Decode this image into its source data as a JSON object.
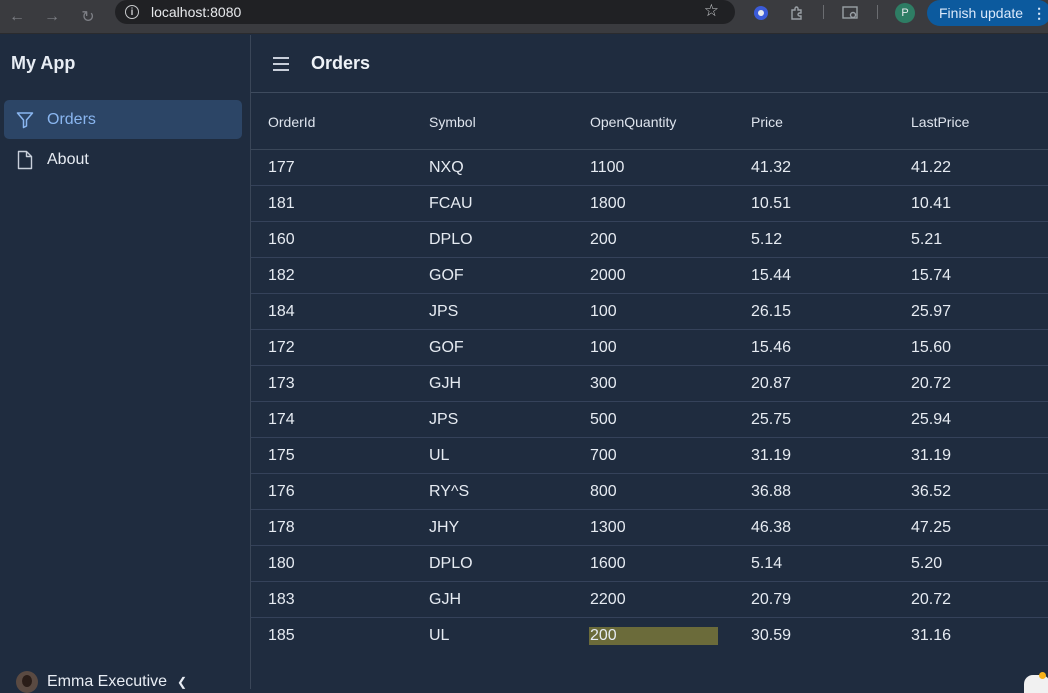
{
  "browser": {
    "url": "localhost:8080",
    "profile_initial": "P",
    "update_label": "Finish update"
  },
  "app": {
    "title": "My App"
  },
  "sidebar": {
    "items": [
      {
        "label": "Orders",
        "icon": "filter-icon",
        "active": true
      },
      {
        "label": "About",
        "icon": "file-icon",
        "active": false
      }
    ]
  },
  "user": {
    "name": "Emma Executive"
  },
  "header": {
    "title": "Orders"
  },
  "table": {
    "columns": [
      "OrderId",
      "Symbol",
      "OpenQuantity",
      "Price",
      "LastPrice"
    ],
    "rows": [
      [
        "177",
        "NXQ",
        "1100",
        "41.32",
        "41.22"
      ],
      [
        "181",
        "FCAU",
        "1800",
        "10.51",
        "10.41"
      ],
      [
        "160",
        "DPLO",
        "200",
        "5.12",
        "5.21"
      ],
      [
        "182",
        "GOF",
        "2000",
        "15.44",
        "15.74"
      ],
      [
        "184",
        "JPS",
        "100",
        "26.15",
        "25.97"
      ],
      [
        "172",
        "GOF",
        "100",
        "15.46",
        "15.60"
      ],
      [
        "173",
        "GJH",
        "300",
        "20.87",
        "20.72"
      ],
      [
        "174",
        "JPS",
        "500",
        "25.75",
        "25.94"
      ],
      [
        "175",
        "UL",
        "700",
        "31.19",
        "31.19"
      ],
      [
        "176",
        "RY^S",
        "800",
        "36.88",
        "36.52"
      ],
      [
        "178",
        "JHY",
        "1300",
        "46.38",
        "47.25"
      ],
      [
        "180",
        "DPLO",
        "1600",
        "5.14",
        "5.20"
      ],
      [
        "183",
        "GJH",
        "2200",
        "20.79",
        "20.72"
      ],
      [
        "185",
        "UL",
        "200",
        "30.59",
        "31.16"
      ]
    ],
    "highlight_color": "#6b6b3a"
  }
}
